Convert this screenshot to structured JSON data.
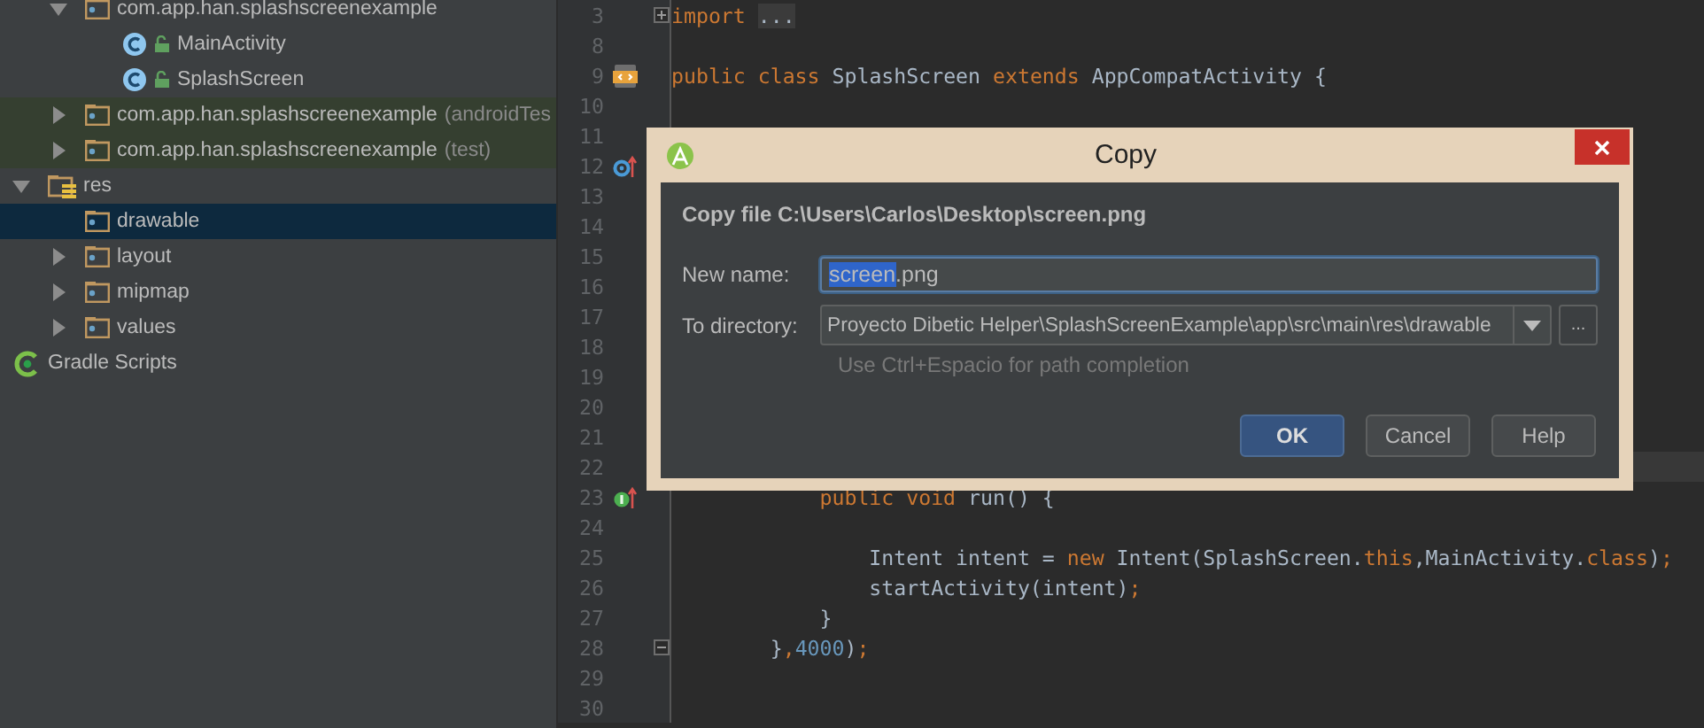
{
  "project_tree": {
    "items": [
      {
        "kind": "offscreen",
        "children": [
          {
            "kind": "folder",
            "label": "com.app.han.splashscreenexample",
            "expanded": true,
            "children": [
              {
                "kind": "class",
                "label": "MainActivity"
              },
              {
                "kind": "class",
                "label": "SplashScreen"
              }
            ]
          },
          {
            "kind": "folder",
            "label": "com.app.han.splashscreenexample",
            "suffix": "(androidTes",
            "expanded": false,
            "test": true
          },
          {
            "kind": "folder",
            "label": "com.app.han.splashscreenexample",
            "suffix": "(test)",
            "expanded": false,
            "test": true
          }
        ]
      },
      {
        "kind": "res",
        "label": "res",
        "expanded": true,
        "children": [
          {
            "kind": "folder",
            "label": "drawable",
            "selected": true
          },
          {
            "kind": "folder",
            "label": "layout",
            "expanded": false,
            "selected": false
          },
          {
            "kind": "folder",
            "label": "mipmap",
            "expanded": false,
            "selected": false
          },
          {
            "kind": "folder",
            "label": "values",
            "expanded": false,
            "selected": false
          }
        ]
      },
      {
        "kind": "gradle",
        "label": "Gradle Scripts"
      }
    ]
  },
  "editor": {
    "lines": [
      {
        "number": "3",
        "fold": {
          "kind": "plus"
        },
        "tokens": [
          {
            "kind": "keyword",
            "text": "import "
          },
          {
            "kind": "folded",
            "text": "..."
          }
        ]
      },
      {
        "number": "8"
      },
      {
        "number": "9",
        "marker": {
          "kind": "class"
        },
        "tokens": [
          {
            "kind": "keyword",
            "text": "public class "
          },
          {
            "kind": "plain",
            "text": "SplashScreen "
          },
          {
            "kind": "keyword",
            "text": "extends "
          },
          {
            "kind": "plain",
            "text": "AppCompatActivity {"
          }
        ]
      },
      {
        "number": "10"
      },
      {
        "number": "11"
      },
      {
        "number": "12",
        "marker": {
          "kind": "override"
        }
      },
      {
        "number": "13"
      },
      {
        "number": "14"
      },
      {
        "number": "15"
      },
      {
        "number": "16"
      },
      {
        "number": "17"
      },
      {
        "number": "18"
      },
      {
        "number": "19"
      },
      {
        "number": "20"
      },
      {
        "number": "21"
      },
      {
        "number": "22",
        "current": true
      },
      {
        "number": "23",
        "marker": {
          "kind": "implements"
        },
        "tokens": [
          {
            "kind": "keyword",
            "text": "            public void "
          },
          {
            "kind": "plain",
            "text": "run() {"
          }
        ]
      },
      {
        "number": "24"
      },
      {
        "number": "25",
        "tokens": [
          {
            "kind": "plain",
            "text": "                Intent intent = "
          },
          {
            "kind": "keyword",
            "text": "new "
          },
          {
            "kind": "plain",
            "text": "Intent(SplashScreen."
          },
          {
            "kind": "keyword",
            "text": "this"
          },
          {
            "kind": "plain",
            "text": ",MainActivity."
          },
          {
            "kind": "keyword",
            "text": "class"
          },
          {
            "kind": "plain",
            "text": ")"
          },
          {
            "kind": "keyword",
            "text": ";"
          }
        ]
      },
      {
        "number": "26",
        "tokens": [
          {
            "kind": "plain",
            "text": "                startActivity(intent)"
          },
          {
            "kind": "keyword",
            "text": ";"
          }
        ]
      },
      {
        "number": "27",
        "tokens": [
          {
            "kind": "plain",
            "text": "            }"
          }
        ]
      },
      {
        "number": "28",
        "fold": {
          "kind": "minus"
        },
        "tokens": [
          {
            "kind": "plain",
            "text": "        }"
          },
          {
            "kind": "keyword",
            "text": ","
          },
          {
            "kind": "number",
            "text": "4000"
          },
          {
            "kind": "plain",
            "text": ")"
          },
          {
            "kind": "keyword",
            "text": ";"
          }
        ]
      },
      {
        "number": "29"
      },
      {
        "number": "30"
      }
    ]
  },
  "dialog": {
    "title": "Copy",
    "heading": "Copy file C:\\Users\\Carlos\\Desktop\\screen.png",
    "name_label": "New name:",
    "name_value": [
      {
        "text": "screen",
        "selected": true
      },
      {
        "text": ".png",
        "selected": false
      }
    ],
    "directory_label": "To directory:",
    "directory_value": "Proyecto Dibetic Helper\\SplashScreenExample\\app\\src\\main\\res\\drawable",
    "browse": "...",
    "hint": "Use Ctrl+Espacio for path completion",
    "buttons": [
      {
        "label": "OK",
        "default": true
      },
      {
        "label": "Cancel",
        "default": false
      },
      {
        "label": "Help",
        "default": false
      }
    ]
  }
}
